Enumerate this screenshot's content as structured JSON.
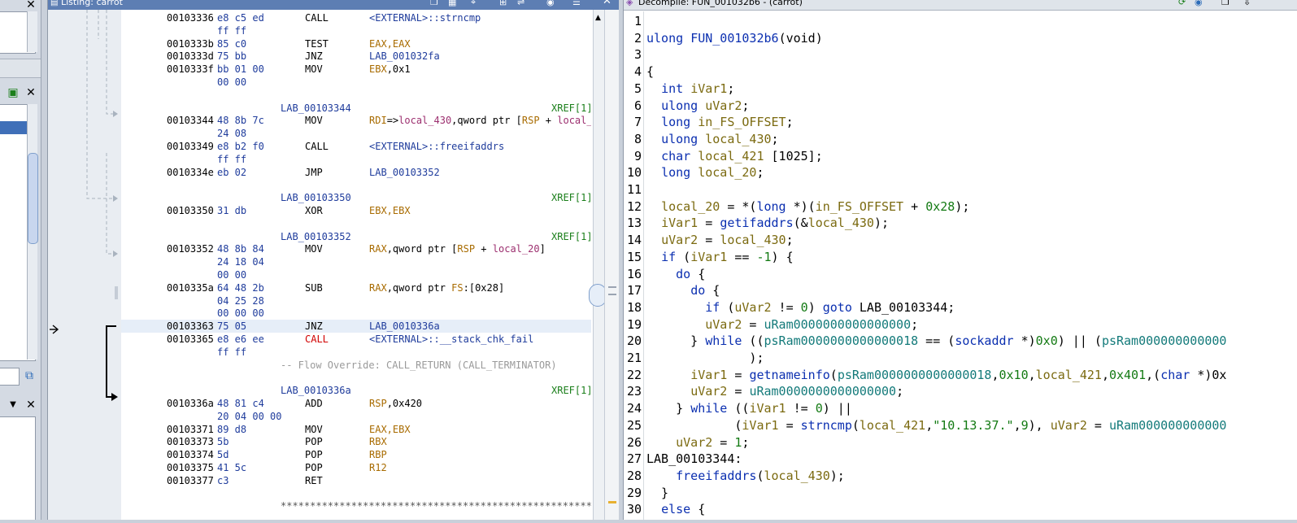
{
  "listing": {
    "title": "Listing:  carrot",
    "rows": [
      {
        "type": "code",
        "addr": "00103336",
        "bytes": "e8 c5 ed",
        "mn": "CALL",
        "ops": [
          {
            "t": "<EXTERNAL>::strncmp",
            "c": "ext"
          }
        ]
      },
      {
        "type": "cont",
        "bytes": "ff ff"
      },
      {
        "type": "code",
        "addr": "0010333b",
        "bytes": "85 c0",
        "mn": "TEST",
        "ops": [
          {
            "t": "EAX,EAX",
            "c": "reg"
          }
        ]
      },
      {
        "type": "code",
        "addr": "0010333d",
        "bytes": "75 bb",
        "mn": "JNZ",
        "ops": [
          {
            "t": "LAB_001032fa",
            "c": "ext"
          }
        ]
      },
      {
        "type": "code",
        "addr": "0010333f",
        "bytes": "bb 01 00",
        "mn": "MOV",
        "ops": [
          {
            "t": "EBX",
            "c": "reg"
          },
          {
            "t": ",0x1",
            "c": ""
          }
        ]
      },
      {
        "type": "cont",
        "bytes": "00 00"
      },
      {
        "type": "blank"
      },
      {
        "type": "label",
        "label": "LAB_00103344",
        "xref": "XREF[1]"
      },
      {
        "type": "code",
        "addr": "00103344",
        "bytes": "48 8b 7c",
        "mn": "MOV",
        "ops": [
          {
            "t": "RDI",
            "c": "reg"
          },
          {
            "t": "=>",
            "c": ""
          },
          {
            "t": "local_430",
            "c": "loc"
          },
          {
            "t": ",qword ptr [",
            "c": ""
          },
          {
            "t": "RSP",
            "c": "reg"
          },
          {
            "t": " + ",
            "c": ""
          },
          {
            "t": "local_43",
            "c": "loc"
          }
        ]
      },
      {
        "type": "cont",
        "bytes": "24 08"
      },
      {
        "type": "code",
        "addr": "00103349",
        "bytes": "e8 b2 f0",
        "mn": "CALL",
        "ops": [
          {
            "t": "<EXTERNAL>::freeifaddrs",
            "c": "ext"
          }
        ]
      },
      {
        "type": "cont",
        "bytes": "ff ff"
      },
      {
        "type": "code",
        "addr": "0010334e",
        "bytes": "eb 02",
        "mn": "JMP",
        "ops": [
          {
            "t": "LAB_00103352",
            "c": "ext"
          }
        ]
      },
      {
        "type": "blank"
      },
      {
        "type": "label",
        "label": "LAB_00103350",
        "xref": "XREF[1]"
      },
      {
        "type": "code",
        "addr": "00103350",
        "bytes": "31 db",
        "mn": "XOR",
        "ops": [
          {
            "t": "EBX,EBX",
            "c": "reg"
          }
        ]
      },
      {
        "type": "blank"
      },
      {
        "type": "label",
        "label": "LAB_00103352",
        "xref": "XREF[1]"
      },
      {
        "type": "code",
        "addr": "00103352",
        "bytes": "48 8b 84",
        "mn": "MOV",
        "ops": [
          {
            "t": "RAX",
            "c": "reg"
          },
          {
            "t": ",qword ptr [",
            "c": ""
          },
          {
            "t": "RSP",
            "c": "reg"
          },
          {
            "t": " + ",
            "c": ""
          },
          {
            "t": "local_20",
            "c": "loc"
          },
          {
            "t": "]",
            "c": ""
          }
        ]
      },
      {
        "type": "cont",
        "bytes": "24 18 04"
      },
      {
        "type": "cont",
        "bytes": "00 00"
      },
      {
        "type": "code",
        "addr": "0010335a",
        "bytes": "64 48 2b",
        "mn": "SUB",
        "ops": [
          {
            "t": "RAX",
            "c": "reg"
          },
          {
            "t": ",qword ptr ",
            "c": ""
          },
          {
            "t": "FS",
            "c": "reg"
          },
          {
            "t": ":[0x28]",
            "c": ""
          }
        ]
      },
      {
        "type": "cont",
        "bytes": "04 25 28"
      },
      {
        "type": "cont",
        "bytes": "00 00 00"
      },
      {
        "type": "code",
        "addr": "00103363",
        "bytes": "75 05",
        "mn": "JNZ",
        "ops": [
          {
            "t": "LAB_0010336a",
            "c": "ext"
          }
        ],
        "hl": true
      },
      {
        "type": "code",
        "addr": "00103365",
        "bytes": "e8 e6 ee",
        "mn": "CALL",
        "mnc": "red",
        "ops": [
          {
            "t": "<EXTERNAL>::__stack_chk_fail",
            "c": "ext"
          }
        ]
      },
      {
        "type": "cont",
        "bytes": "ff ff"
      },
      {
        "type": "comment",
        "text": "-- Flow Override: CALL_RETURN (CALL_TERMINATOR)"
      },
      {
        "type": "blank"
      },
      {
        "type": "label",
        "label": "LAB_0010336a",
        "xref": "XREF[1]"
      },
      {
        "type": "code",
        "addr": "0010336a",
        "bytes": "48 81 c4",
        "mn": "ADD",
        "ops": [
          {
            "t": "RSP",
            "c": "reg"
          },
          {
            "t": ",0x420",
            "c": ""
          }
        ]
      },
      {
        "type": "cont",
        "bytes": "20 04 00 00"
      },
      {
        "type": "code",
        "addr": "00103371",
        "bytes": "89 d8",
        "mn": "MOV",
        "ops": [
          {
            "t": "EAX,EBX",
            "c": "reg"
          }
        ]
      },
      {
        "type": "code",
        "addr": "00103373",
        "bytes": "5b",
        "mn": "POP",
        "ops": [
          {
            "t": "RBX",
            "c": "reg"
          }
        ]
      },
      {
        "type": "code",
        "addr": "00103374",
        "bytes": "5d",
        "mn": "POP",
        "ops": [
          {
            "t": "RBP",
            "c": "reg"
          }
        ]
      },
      {
        "type": "code",
        "addr": "00103375",
        "bytes": "41 5c",
        "mn": "POP",
        "ops": [
          {
            "t": "R12",
            "c": "reg"
          }
        ]
      },
      {
        "type": "code",
        "addr": "00103377",
        "bytes": "c3",
        "mn": "RET",
        "ops": []
      },
      {
        "type": "blank"
      },
      {
        "type": "stars",
        "text": "**************************************************************"
      }
    ]
  },
  "decompile": {
    "title": "Decompile: FUN_001032b6 -  (carrot)",
    "lines": [
      [],
      [
        [
          "k",
          "ulong "
        ],
        [
          "fn",
          "FUN_001032b6"
        ],
        [
          "p",
          "(void)"
        ]
      ],
      [],
      [
        [
          "p",
          "{"
        ]
      ],
      [
        [
          "p",
          "  "
        ],
        [
          "k",
          "int "
        ],
        [
          "v",
          "iVar1"
        ],
        [
          "p",
          ";"
        ]
      ],
      [
        [
          "p",
          "  "
        ],
        [
          "k",
          "ulong "
        ],
        [
          "v",
          "uVar2"
        ],
        [
          "p",
          ";"
        ]
      ],
      [
        [
          "p",
          "  "
        ],
        [
          "k",
          "long "
        ],
        [
          "v",
          "in_FS_OFFSET"
        ],
        [
          "p",
          ";"
        ]
      ],
      [
        [
          "p",
          "  "
        ],
        [
          "k",
          "ulong "
        ],
        [
          "v",
          "local_430"
        ],
        [
          "p",
          ";"
        ]
      ],
      [
        [
          "p",
          "  "
        ],
        [
          "k",
          "char "
        ],
        [
          "v",
          "local_421"
        ],
        [
          "p",
          " [1025];"
        ]
      ],
      [
        [
          "p",
          "  "
        ],
        [
          "k",
          "long "
        ],
        [
          "v",
          "local_20"
        ],
        [
          "p",
          ";"
        ]
      ],
      [],
      [
        [
          "p",
          "  "
        ],
        [
          "v",
          "local_20"
        ],
        [
          "p",
          " = *("
        ],
        [
          "k",
          "long"
        ],
        [
          "p",
          " *)("
        ],
        [
          "v",
          "in_FS_OFFSET"
        ],
        [
          "p",
          " + "
        ],
        [
          "n",
          "0x28"
        ],
        [
          "p",
          ");"
        ]
      ],
      [
        [
          "p",
          "  "
        ],
        [
          "v",
          "iVar1"
        ],
        [
          "p",
          " = "
        ],
        [
          "fn",
          "getifaddrs"
        ],
        [
          "p",
          "(&"
        ],
        [
          "v",
          "local_430"
        ],
        [
          "p",
          ");"
        ]
      ],
      [
        [
          "p",
          "  "
        ],
        [
          "v",
          "uVar2"
        ],
        [
          "p",
          " = "
        ],
        [
          "v",
          "local_430"
        ],
        [
          "p",
          ";"
        ]
      ],
      [
        [
          "p",
          "  "
        ],
        [
          "k",
          "if"
        ],
        [
          "p",
          " ("
        ],
        [
          "v",
          "iVar1"
        ],
        [
          "p",
          " == "
        ],
        [
          "n",
          "-1"
        ],
        [
          "p",
          ") {"
        ]
      ],
      [
        [
          "p",
          "    "
        ],
        [
          "k",
          "do"
        ],
        [
          "p",
          " {"
        ]
      ],
      [
        [
          "p",
          "      "
        ],
        [
          "k",
          "do"
        ],
        [
          "p",
          " {"
        ]
      ],
      [
        [
          "p",
          "        "
        ],
        [
          "k",
          "if"
        ],
        [
          "p",
          " ("
        ],
        [
          "v",
          "uVar2"
        ],
        [
          "p",
          " != "
        ],
        [
          "n",
          "0"
        ],
        [
          "p",
          ") "
        ],
        [
          "k",
          "goto"
        ],
        [
          "p",
          " LAB_00103344;"
        ]
      ],
      [
        [
          "p",
          "        "
        ],
        [
          "v",
          "uVar2"
        ],
        [
          "p",
          " = "
        ],
        [
          "g",
          "uRam0000000000000000"
        ],
        [
          "p",
          ";"
        ]
      ],
      [
        [
          "p",
          "      } "
        ],
        [
          "k",
          "while"
        ],
        [
          "p",
          " (("
        ],
        [
          "g",
          "psRam0000000000000018"
        ],
        [
          "p",
          " == ("
        ],
        [
          "k",
          "sockaddr"
        ],
        [
          "p",
          " *)"
        ],
        [
          "n",
          "0x0"
        ],
        [
          "p",
          ") || ("
        ],
        [
          "g",
          "psRam000000000000"
        ]
      ],
      [
        [
          "p",
          "              );"
        ]
      ],
      [
        [
          "p",
          "      "
        ],
        [
          "v",
          "iVar1"
        ],
        [
          "p",
          " = "
        ],
        [
          "fn",
          "getnameinfo"
        ],
        [
          "p",
          "("
        ],
        [
          "g",
          "psRam0000000000000018"
        ],
        [
          "p",
          ","
        ],
        [
          "n",
          "0x10"
        ],
        [
          "p",
          ","
        ],
        [
          "v",
          "local_421"
        ],
        [
          "p",
          ","
        ],
        [
          "n",
          "0x401"
        ],
        [
          "p",
          ",("
        ],
        [
          "k",
          "char"
        ],
        [
          "p",
          " *)0x"
        ]
      ],
      [
        [
          "p",
          "      "
        ],
        [
          "v",
          "uVar2"
        ],
        [
          "p",
          " = "
        ],
        [
          "g",
          "uRam0000000000000000"
        ],
        [
          "p",
          ";"
        ]
      ],
      [
        [
          "p",
          "    } "
        ],
        [
          "k",
          "while"
        ],
        [
          "p",
          " (("
        ],
        [
          "v",
          "iVar1"
        ],
        [
          "p",
          " != "
        ],
        [
          "n",
          "0"
        ],
        [
          "p",
          ") ||"
        ]
      ],
      [
        [
          "p",
          "            ("
        ],
        [
          "v",
          "iVar1"
        ],
        [
          "p",
          " = "
        ],
        [
          "fn",
          "strncmp"
        ],
        [
          "p",
          "("
        ],
        [
          "v",
          "local_421"
        ],
        [
          "p",
          ","
        ],
        [
          "s",
          "\"10.13.37.\""
        ],
        [
          "p",
          ","
        ],
        [
          "n",
          "9"
        ],
        [
          "p",
          "), "
        ],
        [
          "v",
          "uVar2"
        ],
        [
          "p",
          " = "
        ],
        [
          "g",
          "uRam000000000000"
        ]
      ],
      [
        [
          "p",
          "    "
        ],
        [
          "v",
          "uVar2"
        ],
        [
          "p",
          " = "
        ],
        [
          "n",
          "1"
        ],
        [
          "p",
          ";"
        ]
      ],
      [
        [
          "p",
          "LAB_00103344:"
        ]
      ],
      [
        [
          "p",
          "    "
        ],
        [
          "fn",
          "freeifaddrs"
        ],
        [
          "p",
          "("
        ],
        [
          "v",
          "local_430"
        ],
        [
          "p",
          ");"
        ]
      ],
      [
        [
          "p",
          "  }"
        ]
      ],
      [
        [
          "p",
          "  "
        ],
        [
          "k",
          "else"
        ],
        [
          "p",
          " {"
        ]
      ]
    ]
  }
}
